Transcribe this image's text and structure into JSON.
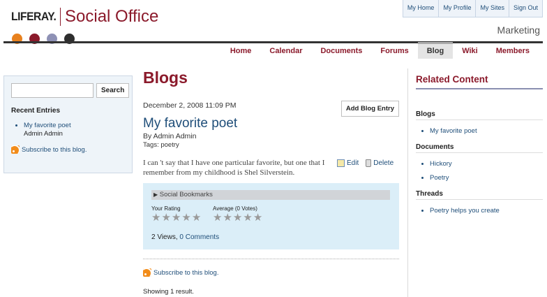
{
  "header": {
    "brand": "LIFERAY.",
    "product": "Social Office",
    "site_name": "Marketing",
    "dot_colors": [
      "#e8811e",
      "#8b1a2b",
      "#8e91b5",
      "#2e2e2e"
    ],
    "top_links": [
      "My Home",
      "My Profile",
      "My Sites",
      "Sign Out"
    ]
  },
  "nav": {
    "items": [
      "Home",
      "Calendar",
      "Documents",
      "Forums",
      "Blog",
      "Wiki",
      "Members"
    ],
    "active": "Blog"
  },
  "sidebar": {
    "search_button": "Search",
    "recent_heading": "Recent Entries",
    "recent_entries": [
      {
        "title": "My favorite poet",
        "author": "Admin Admin"
      }
    ],
    "subscribe": "Subscribe to this blog."
  },
  "main": {
    "title": "Blogs",
    "add_button": "Add Blog Entry",
    "entry": {
      "date": "December 2, 2008 11:09 PM",
      "title": "My favorite poet",
      "byline": "By Admin Admin",
      "tags": "Tags: poetry",
      "body": "I can 't say that I have one particular favorite, but one that I remember from my childhood is Shel Silverstein.",
      "edit": "Edit",
      "delete": "Delete"
    },
    "social": {
      "bookmarks": "Social Bookmarks",
      "your_rating_label": "Your Rating",
      "average_label": "Average (0 Votes)",
      "your_rating_value": 0,
      "average_value": 0,
      "max_stars": 5,
      "views": "2 Views, ",
      "comments": "0 Comments"
    },
    "subscribe": "Subscribe to this blog.",
    "results": "Showing 1 result."
  },
  "related": {
    "title": "Related Content",
    "sections": [
      {
        "heading": "Blogs",
        "items": [
          "My favorite poet"
        ]
      },
      {
        "heading": "Documents",
        "items": [
          "Hickory",
          "Poetry"
        ]
      },
      {
        "heading": "Threads",
        "items": [
          "Poetry helps you create"
        ]
      }
    ]
  }
}
